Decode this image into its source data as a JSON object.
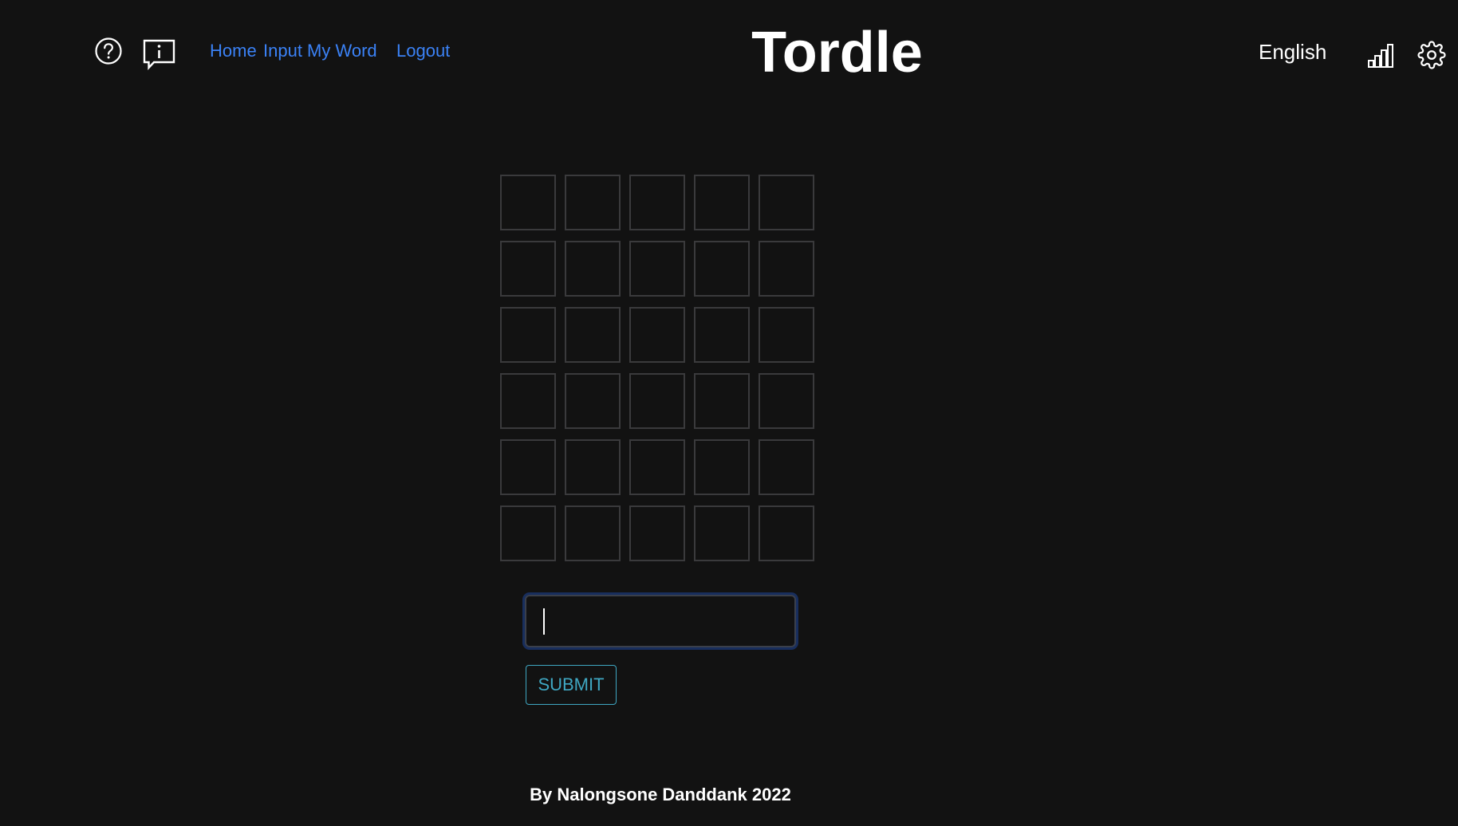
{
  "header": {
    "title": "Tordle",
    "help_icon": "question-circle-icon",
    "info_icon": "info-speech-bubble-icon",
    "nav": {
      "home": "Home",
      "input_my_word": "Input My Word",
      "logout": "Logout"
    },
    "language": "English",
    "stats_icon": "bar-chart-icon",
    "settings_icon": "gear-icon"
  },
  "board": {
    "rows": 6,
    "cols": 5,
    "letters": [
      [
        "",
        "",
        "",
        "",
        ""
      ],
      [
        "",
        "",
        "",
        "",
        ""
      ],
      [
        "",
        "",
        "",
        "",
        ""
      ],
      [
        "",
        "",
        "",
        "",
        ""
      ],
      [
        "",
        "",
        "",
        "",
        ""
      ],
      [
        "",
        "",
        "",
        "",
        ""
      ]
    ]
  },
  "guess": {
    "value": "",
    "submit_label": "SUBMIT"
  },
  "footer": {
    "text": "By Nalongsone Danddank 2022"
  },
  "colors": {
    "background": "#121212",
    "link": "#3b82f6",
    "tile_border": "#3a3a3c",
    "submit": "#3fa7c2",
    "text": "#ffffff"
  }
}
